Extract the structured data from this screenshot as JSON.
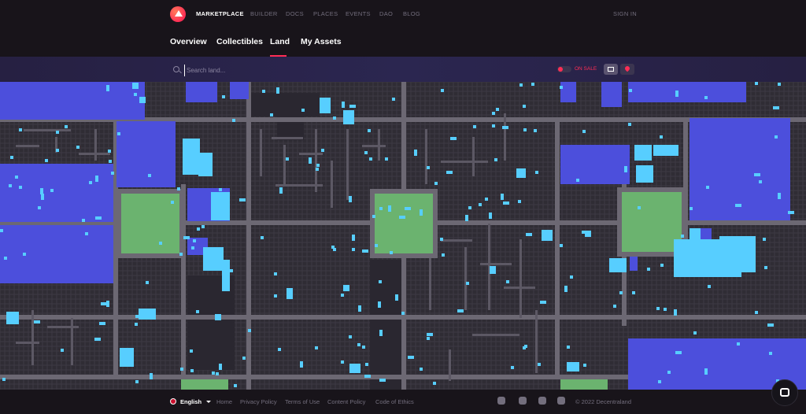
{
  "header": {
    "brand": "MARKETPLACE",
    "nav": [
      "BUILDER",
      "DOCS",
      "PLACES",
      "EVENTS",
      "DAO",
      "BLOG"
    ],
    "signin": "SIGN IN"
  },
  "tabs": [
    "Overview",
    "Collectibles",
    "Land",
    "My Assets"
  ],
  "active_tab": "Land",
  "filter": {
    "search_placeholder": "Search land...",
    "on_sale_label": "ON SALE",
    "on_sale_enabled": false,
    "view_mode": "grid"
  },
  "map": {
    "colors": {
      "background": "#3e3a44",
      "plot": "#2f2c34",
      "road": "#6c6873",
      "plaza": "#6bb36f",
      "district": "#4c4fdc",
      "on_sale": "#57ceff"
    }
  },
  "footer": {
    "language": "English",
    "links": [
      "Home",
      "Privacy Policy",
      "Terms of Use",
      "Content Policy",
      "Code of Ethics"
    ],
    "social_icons": [
      "discord-icon",
      "reddit-icon",
      "github-icon",
      "twitter-icon"
    ],
    "copyright": "© 2022 Decentraland"
  }
}
